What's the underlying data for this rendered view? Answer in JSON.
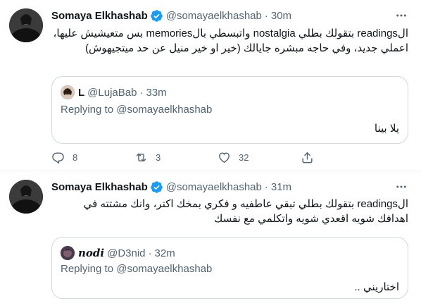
{
  "tweets": [
    {
      "author_name": "Somaya Elkhashab",
      "handle": "@somayaelkhashab",
      "separator": "·",
      "time": "30m",
      "text": "الreadings بتقولك بطلي nostalgia واتبسطي بالmemories بس متعيشيش عليها، اعملي جديد، وفي حاجه مبشره جايالك (خير او خير منيل عن حد ميتجيهوش)",
      "quote": {
        "author_name": "L",
        "handle": "@LujaBab",
        "separator": "·",
        "time": "33m",
        "replying_prefix": "Replying to",
        "replying_to": "@somayaelkhashab",
        "text": "يلا بينا"
      },
      "actions": {
        "reply_count": "8",
        "retweet_count": "3",
        "like_count": "32"
      }
    },
    {
      "author_name": "Somaya Elkhashab",
      "handle": "@somayaelkhashab",
      "separator": "·",
      "time": "31m",
      "text": "الreadings بتقولك بطلي تبقي عاطفيه و فكري بمخك اكتر، وانك مشتته في اهدافك شويه اقعدي شويه واتكلمي مع نفسك",
      "quote": {
        "author_name": "nodi",
        "handle": "@D3nid",
        "separator": "·",
        "time": "32m",
        "replying_prefix": "Replying to",
        "replying_to": "@somayaelkhashab",
        "text": "اختاريني .."
      }
    }
  ],
  "colors": {
    "text": "#0f1419",
    "secondary": "#536471",
    "verified": "#1d9bf0",
    "border": "#cfd9de"
  },
  "icons": {
    "verified": "verified-badge-icon",
    "more": "more-dots-icon",
    "reply": "reply-icon",
    "retweet": "retweet-icon",
    "like": "heart-icon",
    "share": "share-icon"
  }
}
